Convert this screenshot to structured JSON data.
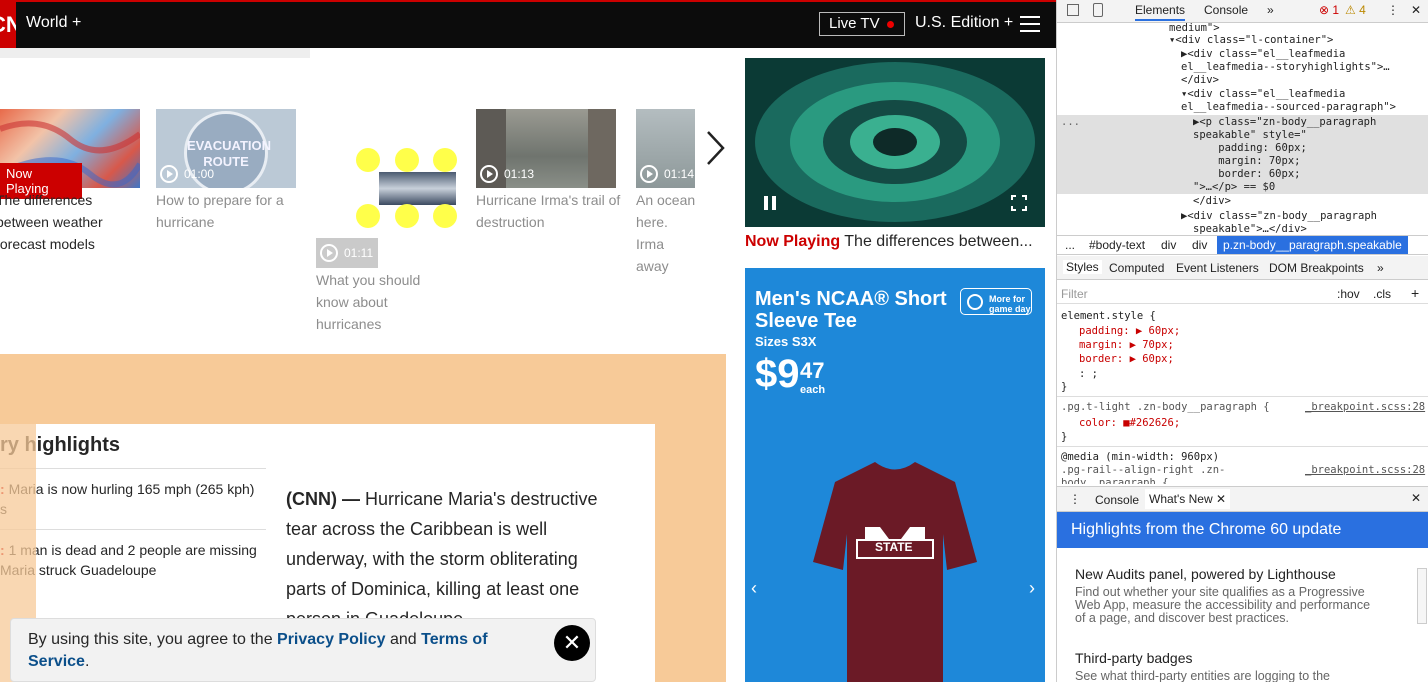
{
  "header": {
    "logo": "CNN",
    "nav_world": "World +",
    "live_tv": "Live TV",
    "edition": "U.S. Edition +"
  },
  "carousel": {
    "now_playing_badge": "Now Playing",
    "items": [
      {
        "caption": "The differences between weather forecast models",
        "duration": ""
      },
      {
        "caption": "How to prepare for a hurricane",
        "duration": "01:00",
        "sign_text": "EVACUATION ROUTE"
      },
      {
        "caption": "What you should know about hurricanes",
        "duration": "01:11"
      },
      {
        "caption": "Hurricane Irma's trail of destruction",
        "duration": "01:13"
      },
      {
        "caption": "An ocean here. Irma away",
        "duration": "01:14"
      }
    ]
  },
  "highlights": {
    "title": "ry highlights",
    "items": [
      {
        "prefix": ":",
        "text": "Maria is now hurling 165 mph (265 kph)",
        "text2": "s"
      },
      {
        "prefix": ":",
        "text": "1 man is dead and 2 people are missing",
        "text2": "Maria struck Guadeloupe"
      }
    ]
  },
  "article": {
    "dateline": "(CNN) —",
    "body": "Hurricane Maria's destructive tear across the Caribbean is well underway, with the storm obliterating parts of Dominica, killing at least one person in Guadeloupe"
  },
  "cookie": {
    "text_before": "By using this site, you agree to the ",
    "privacy": "Privacy Policy",
    "and": " and ",
    "terms": "Terms of Service",
    "period": "."
  },
  "sidebar": {
    "now_playing_label": "Now Playing",
    "now_playing_title": "The differences between...",
    "ad": {
      "headline": "Men's NCAA® Short Sleeve Tee",
      "sizes": "Sizes S3X",
      "price_dollars": "$9",
      "price_cents": "47",
      "price_unit": "each",
      "more_btn": "More for game day",
      "shirt_text": "STATE"
    }
  },
  "devtools": {
    "tabs": [
      "Elements",
      "Console"
    ],
    "errors": "1",
    "warnings": "4",
    "dom_lines": [
      {
        "indent": 0,
        "text": "medium\">"
      },
      {
        "indent": 1,
        "text": "▾<div class=\"l-container\">"
      },
      {
        "indent": 2,
        "text": "▶<div class=\"el__leafmedia"
      },
      {
        "indent": 2,
        "text": "el__leafmedia--storyhighlights\">…"
      },
      {
        "indent": 2,
        "text": "</div>"
      },
      {
        "indent": 2,
        "text": "▾<div class=\"el__leafmedia"
      },
      {
        "indent": 2,
        "text": "el__leafmedia--sourced-paragraph\">"
      }
    ],
    "selected_lines": [
      "▶<p class=\"zn-body__paragraph",
      "speakable\" style=\"",
      "    padding: 60px;",
      "    margin: 70px;",
      "    border: 60px;",
      "\">…</p> == $0"
    ],
    "after_lines": [
      "</div>",
      "▶<div class=\"zn-body__paragraph",
      "speakable\">…</div>"
    ],
    "breadcrumb": [
      "...",
      "#body-text",
      "div",
      "div",
      "p.zn-body__paragraph.speakable"
    ],
    "style_tabs": [
      "Styles",
      "Computed",
      "Event Listeners",
      "DOM Breakpoints"
    ],
    "filter": "Filter",
    "hov": ":hov",
    "cls": ".cls",
    "element_style": "element.style {",
    "style_props": [
      "padding: ▶ 60px;",
      "margin: ▶ 70px;",
      "border: ▶ 60px;",
      ": ;"
    ],
    "rule2_selector": ".pg.t-light .zn-body__paragraph {",
    "rule2_source": "_breakpoint.scss:28",
    "rule2_prop": "color: ■#262626;",
    "media": "@media (min-width: 960px)",
    "rule3_selector": ".pg-rail--align-right .zn-",
    "rule3_cont": "body__paragraph {",
    "drawer_tabs": [
      "Console",
      "What's New"
    ],
    "whats_new_banner": "Highlights from the Chrome 60 update",
    "whats_new": [
      {
        "title": "New Audits panel, powered by Lighthouse",
        "desc": "Find out whether your site qualifies as a Progressive Web App, measure the accessibility and performance of a page, and discover best practices."
      },
      {
        "title": "Third-party badges",
        "desc": "See what third-party entities are logging to the"
      }
    ]
  }
}
